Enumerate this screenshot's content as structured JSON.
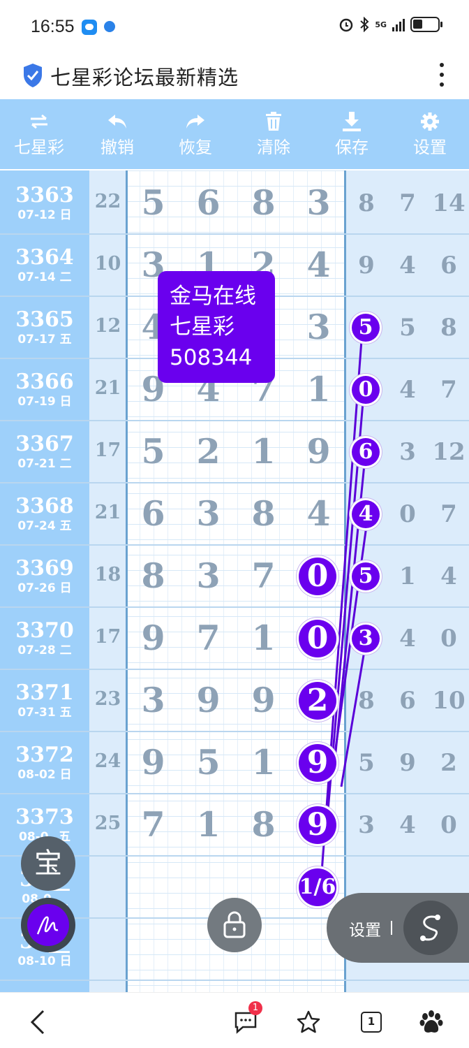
{
  "status_bar": {
    "time": "16:55",
    "network": "5G"
  },
  "header": {
    "title": "七星彩论坛最新精选",
    "icons": [
      "shield-icon",
      "more-vert-icon"
    ]
  },
  "toolbar": {
    "items": [
      {
        "label": "七星彩",
        "icon": "swap-icon"
      },
      {
        "label": "撤销",
        "icon": "undo-icon"
      },
      {
        "label": "恢复",
        "icon": "redo-icon"
      },
      {
        "label": "清除",
        "icon": "trash-icon"
      },
      {
        "label": "保存",
        "icon": "download-icon"
      },
      {
        "label": "设置",
        "icon": "gear-icon"
      }
    ]
  },
  "rows": [
    {
      "issue": "3363",
      "date": "07-12 日",
      "sum": "22",
      "digits": [
        "5",
        "6",
        "8",
        "3"
      ],
      "tail": [
        "8",
        "7",
        "14"
      ]
    },
    {
      "issue": "3364",
      "date": "07-14 二",
      "sum": "10",
      "digits": [
        "3",
        "1",
        "2",
        "4"
      ],
      "tail": [
        "9",
        "4",
        "6"
      ]
    },
    {
      "issue": "3365",
      "date": "07-17 五",
      "sum": "12",
      "digits": [
        "4",
        "",
        "",
        "3"
      ],
      "tail": [
        "",
        "5",
        "8"
      ]
    },
    {
      "issue": "3366",
      "date": "07-19 日",
      "sum": "21",
      "digits": [
        "9",
        "4",
        "7",
        "1"
      ],
      "tail": [
        "",
        "4",
        "7"
      ]
    },
    {
      "issue": "3367",
      "date": "07-21 二",
      "sum": "17",
      "digits": [
        "5",
        "2",
        "1",
        "9"
      ],
      "tail": [
        "",
        "3",
        "12"
      ]
    },
    {
      "issue": "3368",
      "date": "07-24 五",
      "sum": "21",
      "digits": [
        "6",
        "3",
        "8",
        "4"
      ],
      "tail": [
        "",
        "0",
        "7"
      ]
    },
    {
      "issue": "3369",
      "date": "07-26 日",
      "sum": "18",
      "digits": [
        "8",
        "3",
        "7",
        ""
      ],
      "tail": [
        "",
        "1",
        "4"
      ]
    },
    {
      "issue": "3370",
      "date": "07-28 二",
      "sum": "17",
      "digits": [
        "9",
        "7",
        "1",
        ""
      ],
      "tail": [
        "",
        "4",
        "0"
      ]
    },
    {
      "issue": "3371",
      "date": "07-31 五",
      "sum": "23",
      "digits": [
        "3",
        "9",
        "9",
        ""
      ],
      "tail": [
        "8",
        "6",
        "10"
      ]
    },
    {
      "issue": "3372",
      "date": "08-02 日",
      "sum": "24",
      "digits": [
        "9",
        "5",
        "1",
        ""
      ],
      "tail": [
        "5",
        "9",
        "2"
      ]
    },
    {
      "issue": "3373",
      "date": "08-0_ 五",
      "sum": "25",
      "digits": [
        "7",
        "1",
        "8",
        ""
      ],
      "tail": [
        "3",
        "4",
        "0"
      ]
    },
    {
      "issue": "33__",
      "date": "08-0_ _",
      "sum": "",
      "digits": [
        "",
        "",
        "",
        ""
      ],
      "tail": [
        "",
        "",
        ""
      ]
    },
    {
      "issue": "33__",
      "date": "08-10 日",
      "sum": "",
      "digits": [
        "",
        "",
        "",
        ""
      ],
      "tail": [
        "",
        "",
        ""
      ]
    }
  ],
  "popup": {
    "line1": "金马在线",
    "line2": "七星彩",
    "line3": "508344"
  },
  "marks": {
    "col5_small": [
      "5",
      "0",
      "6",
      "4",
      "5",
      "3"
    ],
    "col4_big": [
      "0",
      "0",
      "2",
      "9",
      "9"
    ],
    "fraction": "1/6"
  },
  "floating": {
    "bao_label": "宝",
    "settings_label": "设置"
  },
  "bottom_nav": {
    "message_badge": "1",
    "tab_count": "1"
  },
  "colors": {
    "toolbar_bg": "#9fd1fb",
    "issue_col_bg": "#9ed0fa",
    "accent_purple": "#6a00ee",
    "digit_gray": "#8ea2b6"
  }
}
